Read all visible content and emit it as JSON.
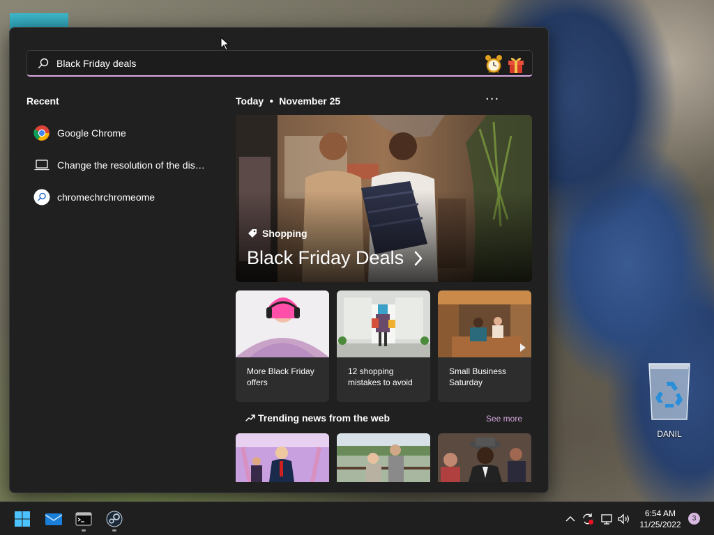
{
  "search": {
    "query": "Black Friday deals"
  },
  "recent": {
    "title": "Recent",
    "items": [
      {
        "label": "Google Chrome",
        "icon": "chrome-icon"
      },
      {
        "label": "Change the resolution of the display",
        "icon": "laptop-icon"
      },
      {
        "label": "chromechrchromeome",
        "icon": "search-result-icon"
      }
    ]
  },
  "feed": {
    "day": "Today",
    "date": "November 25",
    "hero": {
      "category": "Shopping",
      "headline": "Black Friday Deals"
    },
    "cards": [
      {
        "title": "More Black Friday offers"
      },
      {
        "title": "12 shopping mistakes to avoid"
      },
      {
        "title": "Small Business Saturday"
      }
    ],
    "trending": {
      "title": "Trending news from the web",
      "see_more": "See more"
    }
  },
  "desktop": {
    "recycle_bin_label": "DANIL"
  },
  "taskbar": {
    "time": "6:54 AM",
    "date": "11/25/2022",
    "notification_count": "3"
  },
  "colors": {
    "accent": "#d9a9e2",
    "panel_bg": "#202020",
    "taskbar_bg": "#1f1f1f"
  }
}
